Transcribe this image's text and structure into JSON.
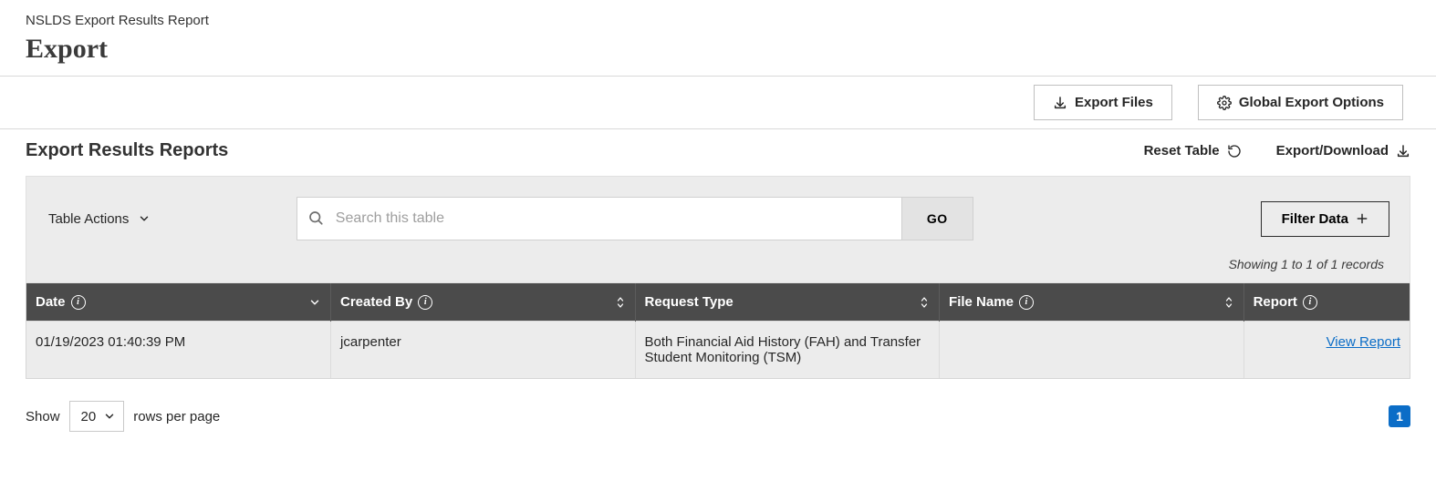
{
  "breadcrumb": "NSLDS Export Results Report",
  "page_title": "Export",
  "toolbar": {
    "export_files_label": "Export Files",
    "global_export_label": "Global Export Options"
  },
  "section": {
    "title": "Export Results Reports",
    "reset_label": "Reset Table",
    "export_download_label": "Export/Download"
  },
  "controls": {
    "table_actions_label": "Table Actions",
    "search_placeholder": "Search this table",
    "go_label": "GO",
    "filter_label": "Filter Data",
    "records_text": "Showing 1 to 1 of 1 records"
  },
  "columns": {
    "date": "Date",
    "created_by": "Created By",
    "request_type": "Request Type",
    "file_name": "File Name",
    "report": "Report"
  },
  "rows": [
    {
      "date": "01/19/2023 01:40:39 PM",
      "created_by": "jcarpenter",
      "request_type": "Both Financial Aid History (FAH) and Transfer Student Monitoring (TSM)",
      "file_name": "",
      "report_link": "View Report"
    }
  ],
  "pager": {
    "show_label": "Show",
    "page_size": "20",
    "rows_label": "rows per page",
    "current_page": "1"
  }
}
